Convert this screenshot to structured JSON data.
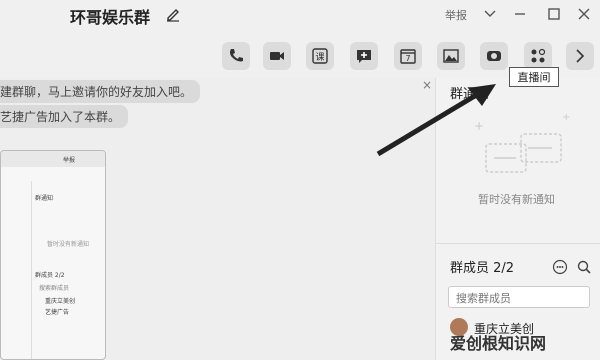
{
  "titlebar": {
    "title": "环哥娱乐群",
    "report": "举报"
  },
  "tooltip": {
    "text": "直播间"
  },
  "toolbar": {
    "homework_label": "课",
    "calendar_label": "7"
  },
  "chat": {
    "messages": [
      "建群聊，马上邀请你的好友加入吧。",
      "艺捷广告加入了本群。"
    ],
    "close": "×"
  },
  "inset": {
    "header": "举报",
    "notice": "群通知",
    "notice_empty": "暂时没有新通知",
    "members": "群成员 2/2",
    "search": "搜索群成员",
    "member1": "重庆立美创",
    "member2": "艺捷广告"
  },
  "panel": {
    "notice_title": "群通知",
    "notice_empty": "暂时没有新通知",
    "members_title": "群成员 2/2",
    "search_placeholder": "搜索群成员",
    "member_name": "重庆立美创"
  },
  "watermark": {
    "text": "爱创根知识网"
  },
  "colors": {
    "background": "#f0f0f0",
    "button": "#dcdcdc",
    "arrow": "#222222"
  }
}
